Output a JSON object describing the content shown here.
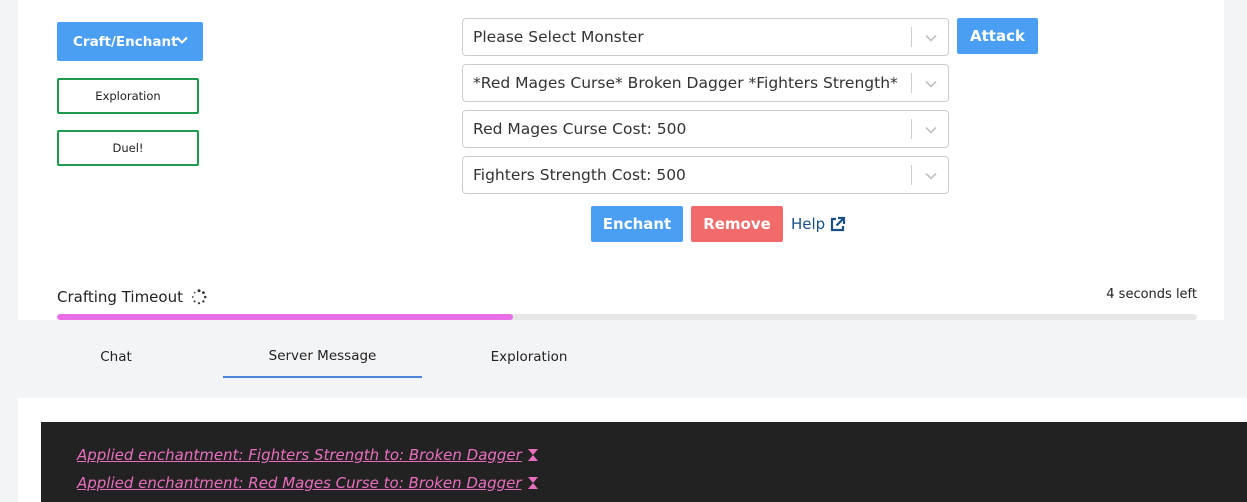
{
  "left_actions": {
    "craft_button": "Craft/Enchant",
    "exploration_button": "Exploration",
    "duel_button": "Duel!"
  },
  "selects": {
    "monster": "Please Select Monster",
    "item": "*Red Mages Curse* Broken Dagger *Fighters Strength*",
    "affix_one": "Red Mages Curse Cost: 500",
    "affix_two": "Fighters Strength Cost: 500"
  },
  "buttons": {
    "attack": "Attack",
    "enchant": "Enchant",
    "remove": "Remove",
    "help": "Help"
  },
  "timeout": {
    "label": "Crafting Timeout",
    "time_left": "4 seconds left",
    "progress_fraction": 0.4
  },
  "tabs": [
    {
      "label": "Chat",
      "active": false
    },
    {
      "label": "Server Message",
      "active": true
    },
    {
      "label": "Exploration",
      "active": false
    }
  ],
  "messages": [
    "Applied enchantment: Fighters Strength to: Broken Dagger",
    "Applied enchantment: Red Mages Curse to: Broken Dagger"
  ],
  "colors": {
    "primary": "#4a9ff5",
    "danger": "#f26b6b",
    "success_outline": "#1e9a4f",
    "progress": "#e86ee8",
    "message": "#e96fbe",
    "console_bg": "#222222"
  }
}
